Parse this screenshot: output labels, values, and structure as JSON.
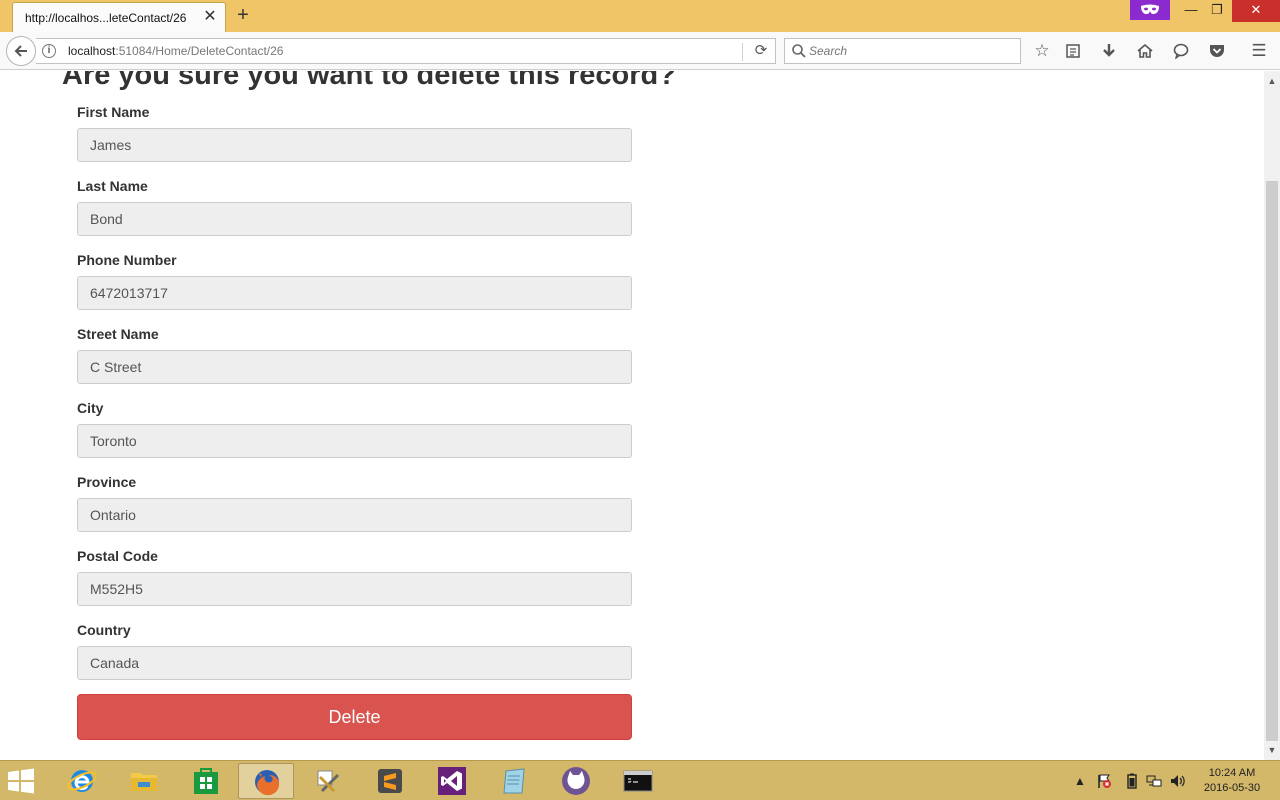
{
  "browser": {
    "tab_title": "http://localhos...leteContact/26",
    "url_host": "localhost",
    "url_rest": ":51084/Home/DeleteContact/26",
    "search_placeholder": "Search",
    "private_badge_icon": "mask-icon",
    "accent_color": "#f0c567"
  },
  "page": {
    "heading": "Are you sure you want to delete this record?",
    "fields": [
      {
        "label": "First Name",
        "value": "James"
      },
      {
        "label": "Last Name",
        "value": "Bond"
      },
      {
        "label": "Phone Number",
        "value": "6472013717"
      },
      {
        "label": "Street Name",
        "value": "C Street"
      },
      {
        "label": "City",
        "value": "Toronto"
      },
      {
        "label": "Province",
        "value": "Ontario"
      },
      {
        "label": "Postal Code",
        "value": "M552H5"
      },
      {
        "label": "Country",
        "value": "Canada"
      }
    ],
    "delete_label": "Delete",
    "delete_color": "#d9534f"
  },
  "taskbar": {
    "time": "10:24 AM",
    "date": "2016-05-30"
  }
}
